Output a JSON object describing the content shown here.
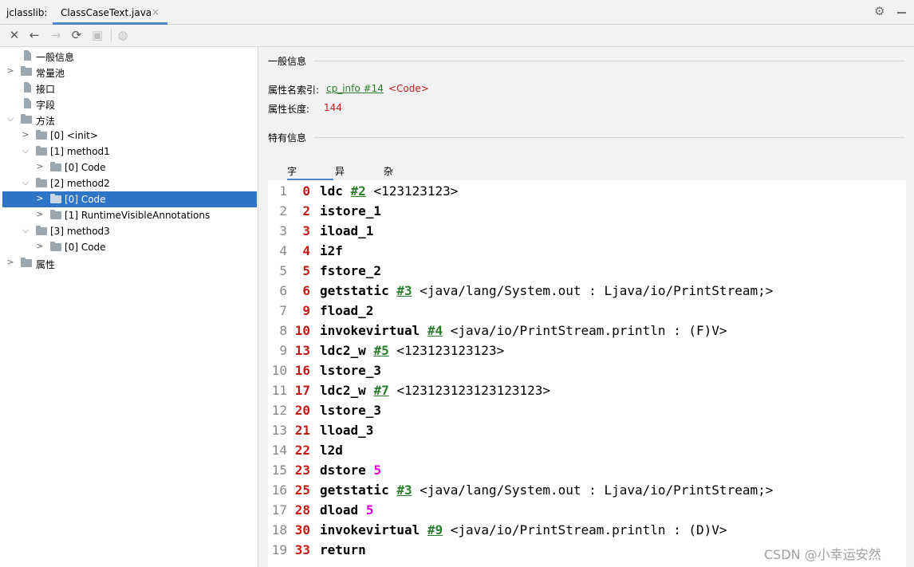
{
  "tool_window": {
    "title": "jclasslib:"
  },
  "editor_tab": {
    "label": "ClassCaseText.java",
    "close_glyph": "×"
  },
  "toolbar": {
    "icons": [
      "close-icon",
      "back-icon",
      "forward-icon",
      "refresh-icon",
      "save-icon",
      "browser-icon"
    ]
  },
  "tree": {
    "items": [
      {
        "label": "一般信息"
      },
      {
        "label": "常量池"
      },
      {
        "label": "接口"
      },
      {
        "label": "字段"
      },
      {
        "label": "方法"
      },
      {
        "label": "[0] <init>"
      },
      {
        "label": "[1] method1"
      },
      {
        "label": "[0] Code"
      },
      {
        "label": "[2] method2"
      },
      {
        "label": "[0] Code"
      },
      {
        "label": "[1] RuntimeVisibleAnnotations"
      },
      {
        "label": "[3] method3"
      },
      {
        "label": "[0] Code"
      },
      {
        "label": "属性"
      }
    ]
  },
  "general": {
    "section_title": "一般信息",
    "name_index_label": "属性名索引:",
    "name_index_link": "cp_info #14",
    "name_index_value": "<Code>",
    "length_label": "属性长度:",
    "length_value": "144"
  },
  "specific": {
    "section_title": "特有信息",
    "tabs": [
      "字节码",
      "异常表",
      "杂项"
    ]
  },
  "bytecode": [
    {
      "line": "1",
      "offset": "0",
      "op": "ldc",
      "ref": "#2",
      "comment": "<123123123>"
    },
    {
      "line": "2",
      "offset": "2",
      "op": "istore_1"
    },
    {
      "line": "3",
      "offset": "3",
      "op": "iload_1"
    },
    {
      "line": "4",
      "offset": "4",
      "op": "i2f"
    },
    {
      "line": "5",
      "offset": "5",
      "op": "fstore_2"
    },
    {
      "line": "6",
      "offset": "6",
      "op": "getstatic",
      "ref": "#3",
      "comment": "<java/lang/System.out : Ljava/io/PrintStream;>"
    },
    {
      "line": "7",
      "offset": "9",
      "op": "fload_2"
    },
    {
      "line": "8",
      "offset": "10",
      "op": "invokevirtual",
      "ref": "#4",
      "comment": "<java/io/PrintStream.println : (F)V>"
    },
    {
      "line": "9",
      "offset": "13",
      "op": "ldc2_w",
      "ref": "#5",
      "comment": "<123123123123>"
    },
    {
      "line": "10",
      "offset": "16",
      "op": "lstore_3"
    },
    {
      "line": "11",
      "offset": "17",
      "op": "ldc2_w",
      "ref": "#7",
      "comment": "<123123123123123123>"
    },
    {
      "line": "12",
      "offset": "20",
      "op": "lstore_3"
    },
    {
      "line": "13",
      "offset": "21",
      "op": "lload_3"
    },
    {
      "line": "14",
      "offset": "22",
      "op": "l2d"
    },
    {
      "line": "15",
      "offset": "23",
      "op": "dstore",
      "num": "5"
    },
    {
      "line": "16",
      "offset": "25",
      "op": "getstatic",
      "ref": "#3",
      "comment": "<java/lang/System.out : Ljava/io/PrintStream;>"
    },
    {
      "line": "17",
      "offset": "28",
      "op": "dload",
      "num": "5"
    },
    {
      "line": "18",
      "offset": "30",
      "op": "invokevirtual",
      "ref": "#9",
      "comment": "<java/io/PrintStream.println : (D)V>"
    },
    {
      "line": "19",
      "offset": "33",
      "op": "return"
    }
  ],
  "watermark": "CSDN @小幸运安然"
}
